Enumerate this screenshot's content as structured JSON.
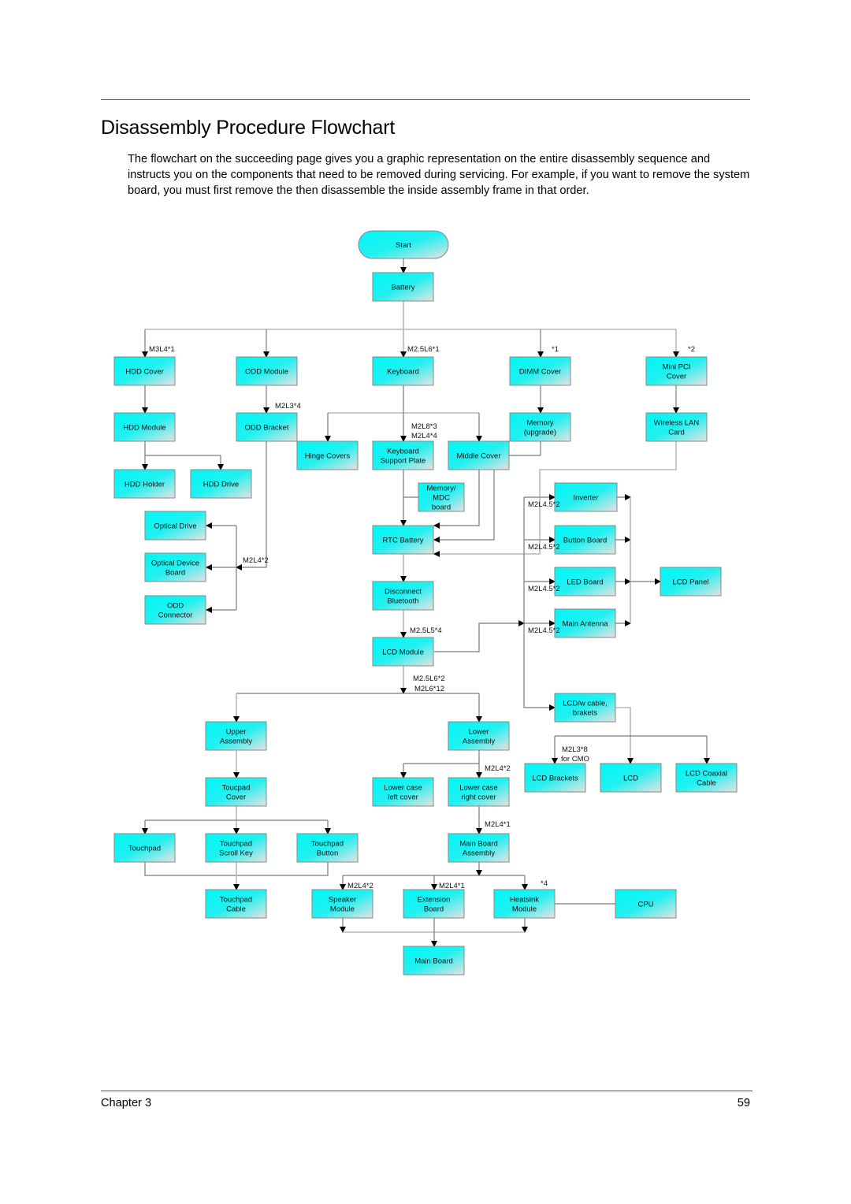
{
  "page": {
    "title": "Disassembly Procedure Flowchart",
    "intro": "The flowchart on the succeeding page gives you a graphic representation on the entire disassembly sequence and instructs you on the components that need to be removed during servicing. For example, if you want to remove the system board, you must first remove the then disassemble the inside assembly frame in that order.",
    "footer_left": "Chapter 3",
    "footer_right": "59"
  },
  "colors": {
    "node_fill": "#00f5f5",
    "node_fade": "#e6e6e6",
    "line": "#7a7a7a"
  },
  "flowchart": {
    "nodes": [
      {
        "id": "start",
        "lines": [
          "Start"
        ],
        "shape": "terminal"
      },
      {
        "id": "battery",
        "lines": [
          "Battery"
        ]
      },
      {
        "id": "hdd-cover",
        "lines": [
          "HDD Cover"
        ]
      },
      {
        "id": "odd-module",
        "lines": [
          "ODD Module"
        ]
      },
      {
        "id": "keyboard",
        "lines": [
          "Keyboard"
        ]
      },
      {
        "id": "dimm-cover",
        "lines": [
          "DIMM Cover"
        ]
      },
      {
        "id": "mini-pci-cover",
        "lines": [
          "Mini PCI",
          "Cover"
        ]
      },
      {
        "id": "hdd-module",
        "lines": [
          "HDD Module"
        ]
      },
      {
        "id": "odd-bracket",
        "lines": [
          "ODD Bracket"
        ]
      },
      {
        "id": "memory-upgrade",
        "lines": [
          "Memory",
          "(upgrade)"
        ]
      },
      {
        "id": "wireless-lan-card",
        "lines": [
          "Wireless LAN",
          "Card"
        ]
      },
      {
        "id": "hinge-covers",
        "lines": [
          "Hinge Covers"
        ]
      },
      {
        "id": "keyboard-support-plate",
        "lines": [
          "Keyboard",
          "Support Plate"
        ]
      },
      {
        "id": "middle-cover",
        "lines": [
          "Middle Cover"
        ]
      },
      {
        "id": "hdd-holder",
        "lines": [
          "HDD Holder"
        ]
      },
      {
        "id": "hdd-drive",
        "lines": [
          "HDD Drive"
        ]
      },
      {
        "id": "memory-mdc-board",
        "lines": [
          "Memory/",
          "MDC",
          "board"
        ]
      },
      {
        "id": "inverter",
        "lines": [
          "Inverter"
        ]
      },
      {
        "id": "optical-drive",
        "lines": [
          "Optical Drive"
        ]
      },
      {
        "id": "rtc-battery",
        "lines": [
          "RTC Battery"
        ]
      },
      {
        "id": "button-board",
        "lines": [
          "Button Board"
        ]
      },
      {
        "id": "optical-device-board",
        "lines": [
          "Optical Device",
          "Board"
        ]
      },
      {
        "id": "led-board",
        "lines": [
          "LED Board"
        ]
      },
      {
        "id": "lcd-panel",
        "lines": [
          "LCD Panel"
        ]
      },
      {
        "id": "disconnect-bluetooth",
        "lines": [
          "Disconnect",
          "Bluetooth"
        ]
      },
      {
        "id": "odd-connector",
        "lines": [
          "ODD",
          "Connector"
        ]
      },
      {
        "id": "main-antenna",
        "lines": [
          "Main Antenna"
        ]
      },
      {
        "id": "lcd-module",
        "lines": [
          "LCD Module"
        ]
      },
      {
        "id": "lcd-w-cable-brakets",
        "lines": [
          "LCD/w cable,",
          "brakets"
        ]
      },
      {
        "id": "upper-assembly",
        "lines": [
          "Upper",
          "Assembly"
        ]
      },
      {
        "id": "lower-assembly",
        "lines": [
          "Lower",
          "Assembly"
        ]
      },
      {
        "id": "lcd-brackets",
        "lines": [
          "LCD Brackets"
        ]
      },
      {
        "id": "lcd",
        "lines": [
          "LCD"
        ]
      },
      {
        "id": "lcd-coaxial-cable",
        "lines": [
          "LCD Coaxial",
          "Cable"
        ]
      },
      {
        "id": "toucpad-cover",
        "lines": [
          "Toucpad",
          "Cover"
        ]
      },
      {
        "id": "lower-case-left-cover",
        "lines": [
          "Lower case",
          "left cover"
        ]
      },
      {
        "id": "lower-case-right-cover",
        "lines": [
          "Lower case",
          "right cover"
        ]
      },
      {
        "id": "touchpad",
        "lines": [
          "Touchpad"
        ]
      },
      {
        "id": "touchpad-scroll-key",
        "lines": [
          "Touchpad",
          "Scroll Key"
        ]
      },
      {
        "id": "touchpad-button",
        "lines": [
          "Touchpad",
          "Button"
        ]
      },
      {
        "id": "main-board-assembly",
        "lines": [
          "Main Board",
          "Assembly"
        ]
      },
      {
        "id": "touchpad-cable",
        "lines": [
          "Touchpad",
          "Cable"
        ]
      },
      {
        "id": "speaker-module",
        "lines": [
          "Speaker",
          "Module"
        ]
      },
      {
        "id": "extension-board",
        "lines": [
          "Extension",
          "Board"
        ]
      },
      {
        "id": "heatsink-module",
        "lines": [
          "Heatsink",
          "Module"
        ]
      },
      {
        "id": "cpu",
        "lines": [
          "CPU"
        ]
      },
      {
        "id": "main-board",
        "lines": [
          "Main Board"
        ]
      }
    ],
    "labels": [
      {
        "id": "hdd-cover-screws",
        "text": "M3L4*1"
      },
      {
        "id": "keyboard-screws",
        "text": "M2.5L6*1"
      },
      {
        "id": "dimm-note",
        "text": "*1"
      },
      {
        "id": "mini-pci-note",
        "text": "*2"
      },
      {
        "id": "odd-bracket-screws",
        "text": "M2L3*4"
      },
      {
        "id": "kb-plate-screws-1",
        "text": "M2L8*3"
      },
      {
        "id": "kb-plate-screws-2",
        "text": "M2L4*4"
      },
      {
        "id": "inverter-screws",
        "text": "M2L4.5*2"
      },
      {
        "id": "button-board-screws",
        "text": "M2L4.5*2"
      },
      {
        "id": "led-board-screws",
        "text": "M2L4.5*2"
      },
      {
        "id": "main-antenna-screws",
        "text": "M2L4.5*2"
      },
      {
        "id": "optical-screws",
        "text": "M2L4*2"
      },
      {
        "id": "lcd-module-screws",
        "text": "M2.5L5*4"
      },
      {
        "id": "assembly-screws-1",
        "text": "M2.5L6*2"
      },
      {
        "id": "assembly-screws-2",
        "text": "M2L6*12"
      },
      {
        "id": "lcd-brackets-screws-1",
        "text": "M2L3*8"
      },
      {
        "id": "lcd-brackets-screws-2",
        "text": "for CMO"
      },
      {
        "id": "lower-case-screws",
        "text": "M2L4*2"
      },
      {
        "id": "main-board-assembly-screws",
        "text": "M2L4*1"
      },
      {
        "id": "speaker-screws",
        "text": "M2L4*2"
      },
      {
        "id": "extension-screws",
        "text": "M2L4*1"
      },
      {
        "id": "heatsink-note",
        "text": "*4"
      }
    ]
  }
}
